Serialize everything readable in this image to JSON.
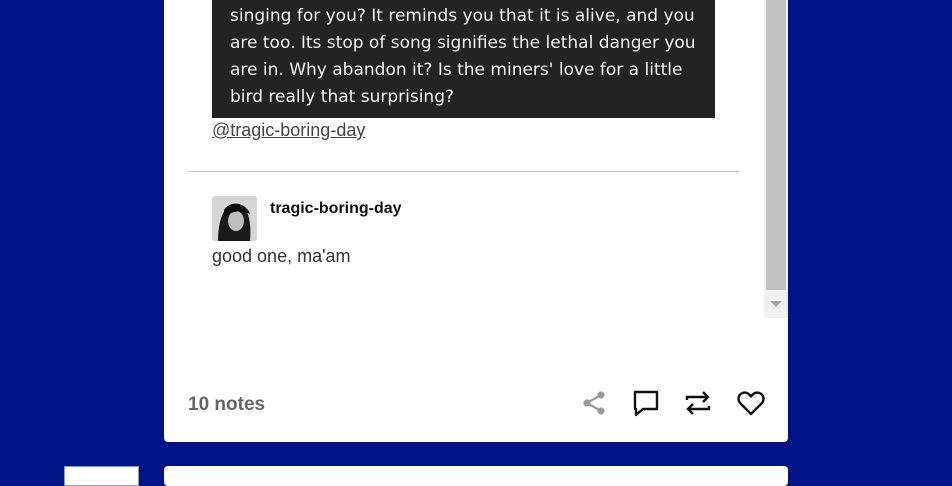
{
  "post": {
    "quote_text": "singing for you? It reminds you that it is alive, and you are too. Its stop of song signifies the lethal danger you are in. Why abandon it? Is the miners' love for a little bird really that surprising?",
    "reblog_link": "@tragic-boring-day"
  },
  "reply": {
    "username": "tragic-boring-day",
    "text": "good one, ma'am"
  },
  "footer": {
    "notes": "10 notes",
    "icons": [
      "share-icon",
      "reply-icon",
      "reblog-icon",
      "like-icon"
    ]
  }
}
